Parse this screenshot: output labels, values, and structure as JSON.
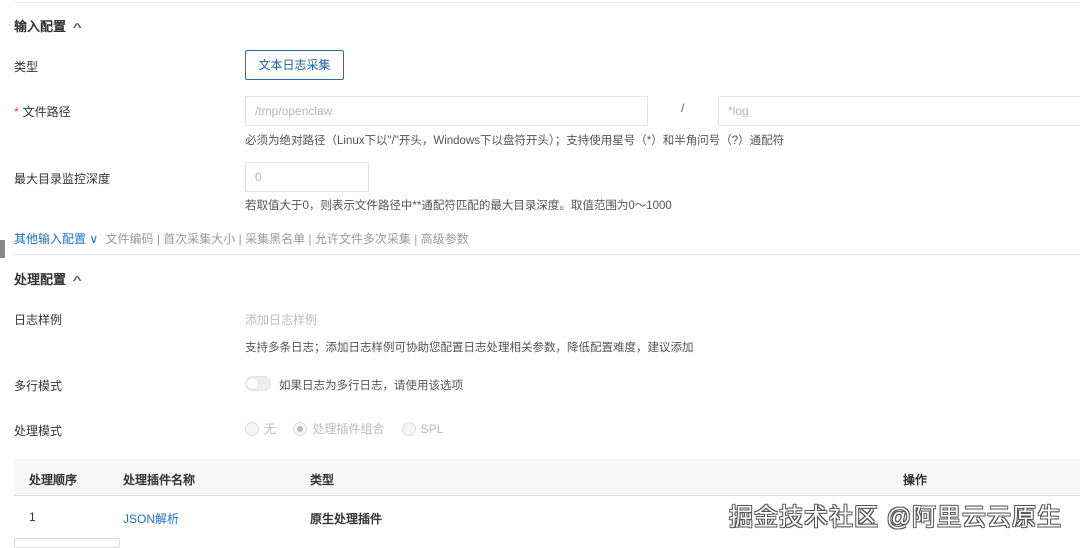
{
  "input_section": {
    "title": "输入配置",
    "type_label": "类型",
    "type_button": "文本日志采集",
    "file_path_label": "文件路径",
    "dir_value": "/tmp/openclaw",
    "separator": "/",
    "file_name_value": "*log",
    "file_path_help": "必须为绝对路径（Linux下以\"/\"开头，Windows下以盘符开头）；支持使用星号（*）和半角问号（?）通配符",
    "max_depth_label": "最大目录监控深度",
    "max_depth_value": "0",
    "max_depth_help": "若取值大于0，则表示文件路径中**通配符匹配的最大目录深度。取值范围为0～1000",
    "other_config_label": "其他输入配置",
    "other_config_items": "文件编码 | 首次采集大小 | 采集黑名单 | 允许文件多次采集 | 高级参数"
  },
  "process_section": {
    "title": "处理配置",
    "log_sample_label": "日志样例",
    "log_sample_placeholder": "添加日志样例",
    "log_sample_help": "支持多条日志；添加日志样例可协助您配置日志处理相关参数，降低配置难度，建议添加",
    "multiline_label": "多行模式",
    "multiline_help": "如果日志为多行日志，请使用该选项",
    "multiline_enabled": false,
    "mode_label": "处理模式",
    "mode_options": [
      "无",
      "处理插件组合",
      "SPL"
    ],
    "mode_selected": "处理插件组合"
  },
  "table": {
    "headers": [
      "处理顺序",
      "处理插件名称",
      "类型",
      "操作"
    ],
    "rows": [
      {
        "order": "1",
        "name": "JSON解析",
        "type": "原生处理插件"
      }
    ]
  },
  "watermark": "掘金技术社区 @阿里云云原生"
}
